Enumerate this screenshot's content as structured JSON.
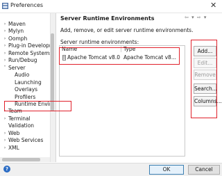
{
  "window": {
    "title": "Preferences",
    "close_glyph": "✕"
  },
  "tree": {
    "items": [
      {
        "label": "Maven",
        "indent": 0,
        "chevron": ">"
      },
      {
        "label": "Mylyn",
        "indent": 0,
        "chevron": ">"
      },
      {
        "label": "Oomph",
        "indent": 0,
        "chevron": ">"
      },
      {
        "label": "Plug-in Developm",
        "indent": 0,
        "chevron": ">"
      },
      {
        "label": "Remote Systems",
        "indent": 0,
        "chevron": ">"
      },
      {
        "label": "Run/Debug",
        "indent": 0,
        "chevron": ">"
      },
      {
        "label": "Server",
        "indent": 0,
        "chevron": "v"
      },
      {
        "label": "Audio",
        "indent": 1,
        "chevron": ""
      },
      {
        "label": "Launching",
        "indent": 1,
        "chevron": ""
      },
      {
        "label": "Overlays",
        "indent": 1,
        "chevron": ""
      },
      {
        "label": "Profilers",
        "indent": 1,
        "chevron": ""
      },
      {
        "label": "Runtime Enviro",
        "indent": 1,
        "chevron": ""
      },
      {
        "label": "Team",
        "indent": 0,
        "chevron": ">"
      },
      {
        "label": "Terminal",
        "indent": 0,
        "chevron": ">"
      },
      {
        "label": "Validation",
        "indent": 0,
        "chevron": ""
      },
      {
        "label": "Web",
        "indent": 0,
        "chevron": ">"
      },
      {
        "label": "Web Services",
        "indent": 0,
        "chevron": ">"
      },
      {
        "label": "XML",
        "indent": 0,
        "chevron": ">"
      }
    ]
  },
  "page": {
    "title": "Server Runtime Environments",
    "nav_arrows": "⇦ ▾ ⇨ ▾",
    "description": "Add, remove, or edit server runtime environments.",
    "list_label": "Server runtime environments:"
  },
  "table": {
    "columns": [
      "Name",
      "Type"
    ],
    "rows": [
      {
        "name": "Apache Tomcat v8.0",
        "type": "Apache Tomcat v8..."
      }
    ]
  },
  "buttons": {
    "add": "Add...",
    "edit": "Edit...",
    "remove": "Remove",
    "search": "Search...",
    "columns": "Columns..."
  },
  "footer": {
    "help": "?",
    "ok": "OK",
    "cancel": "Cancel"
  },
  "colors": {
    "highlight": "#e0202a",
    "accent": "#2b6cc4"
  }
}
